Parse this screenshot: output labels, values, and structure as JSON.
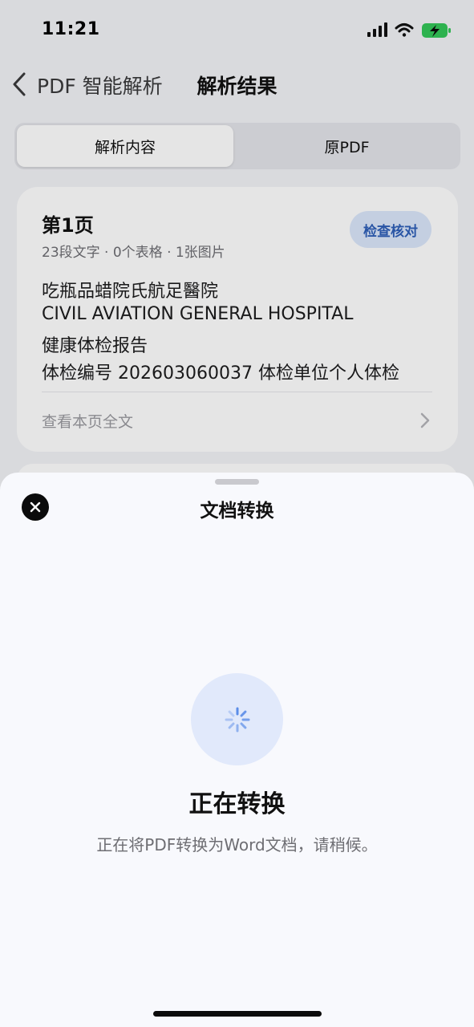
{
  "status_bar": {
    "time": "11:21"
  },
  "nav": {
    "back_label": "PDF 智能解析",
    "title": "解析结果"
  },
  "segmented": {
    "tabs": [
      "解析内容",
      "原PDF"
    ],
    "selected": "解析内容"
  },
  "card": {
    "title": "第1页",
    "meta": "23段文字 · 0个表格 · 1张图片",
    "check_button": "检查核对",
    "lines": [
      "吃瓶品蜡院氏航足醫院",
      "CIVIL AVIATION GENERAL HOSPITAL",
      "健康体检报告",
      "体检编号 202603060037 体检单位个人体检"
    ],
    "view_full": "查看本页全文"
  },
  "sheet": {
    "title": "文档转换",
    "status_title": "正在转换",
    "status_desc": "正在将PDF转换为Word文档，请稍候。",
    "icons": {
      "close": "close-icon",
      "spinner": "loading-spinner-icon"
    }
  },
  "colors": {
    "accent": "#2e5fb8",
    "accent_soft": "#dbe7fb",
    "spinner_bg": "#e1e9fb",
    "spinner_blue": "#5b8de8",
    "battery_green": "#34c759"
  }
}
